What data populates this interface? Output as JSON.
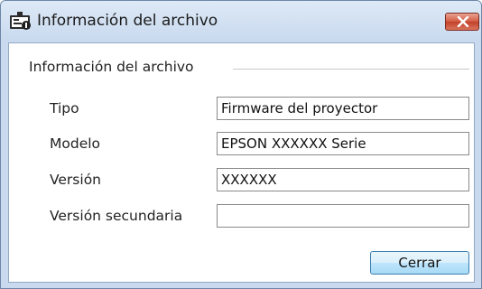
{
  "window": {
    "title": "Información del archivo",
    "icon": "file-info-app-icon",
    "close_icon": "close-icon"
  },
  "group": {
    "label": "Información del archivo"
  },
  "fields": {
    "tipo": {
      "label": "Tipo",
      "value": "Firmware del proyector"
    },
    "modelo": {
      "label": "Modelo",
      "value": "EPSON XXXXXX Serie"
    },
    "version": {
      "label": "Versión",
      "value": "XXXXXX"
    },
    "version_secundaria": {
      "label": "Versión secundaria",
      "value": ""
    }
  },
  "buttons": {
    "close_label": "Cerrar"
  },
  "colors": {
    "close_button": "#c9442b",
    "title_bar": "#c8d9ee",
    "button_border": "#3c7fb1"
  }
}
